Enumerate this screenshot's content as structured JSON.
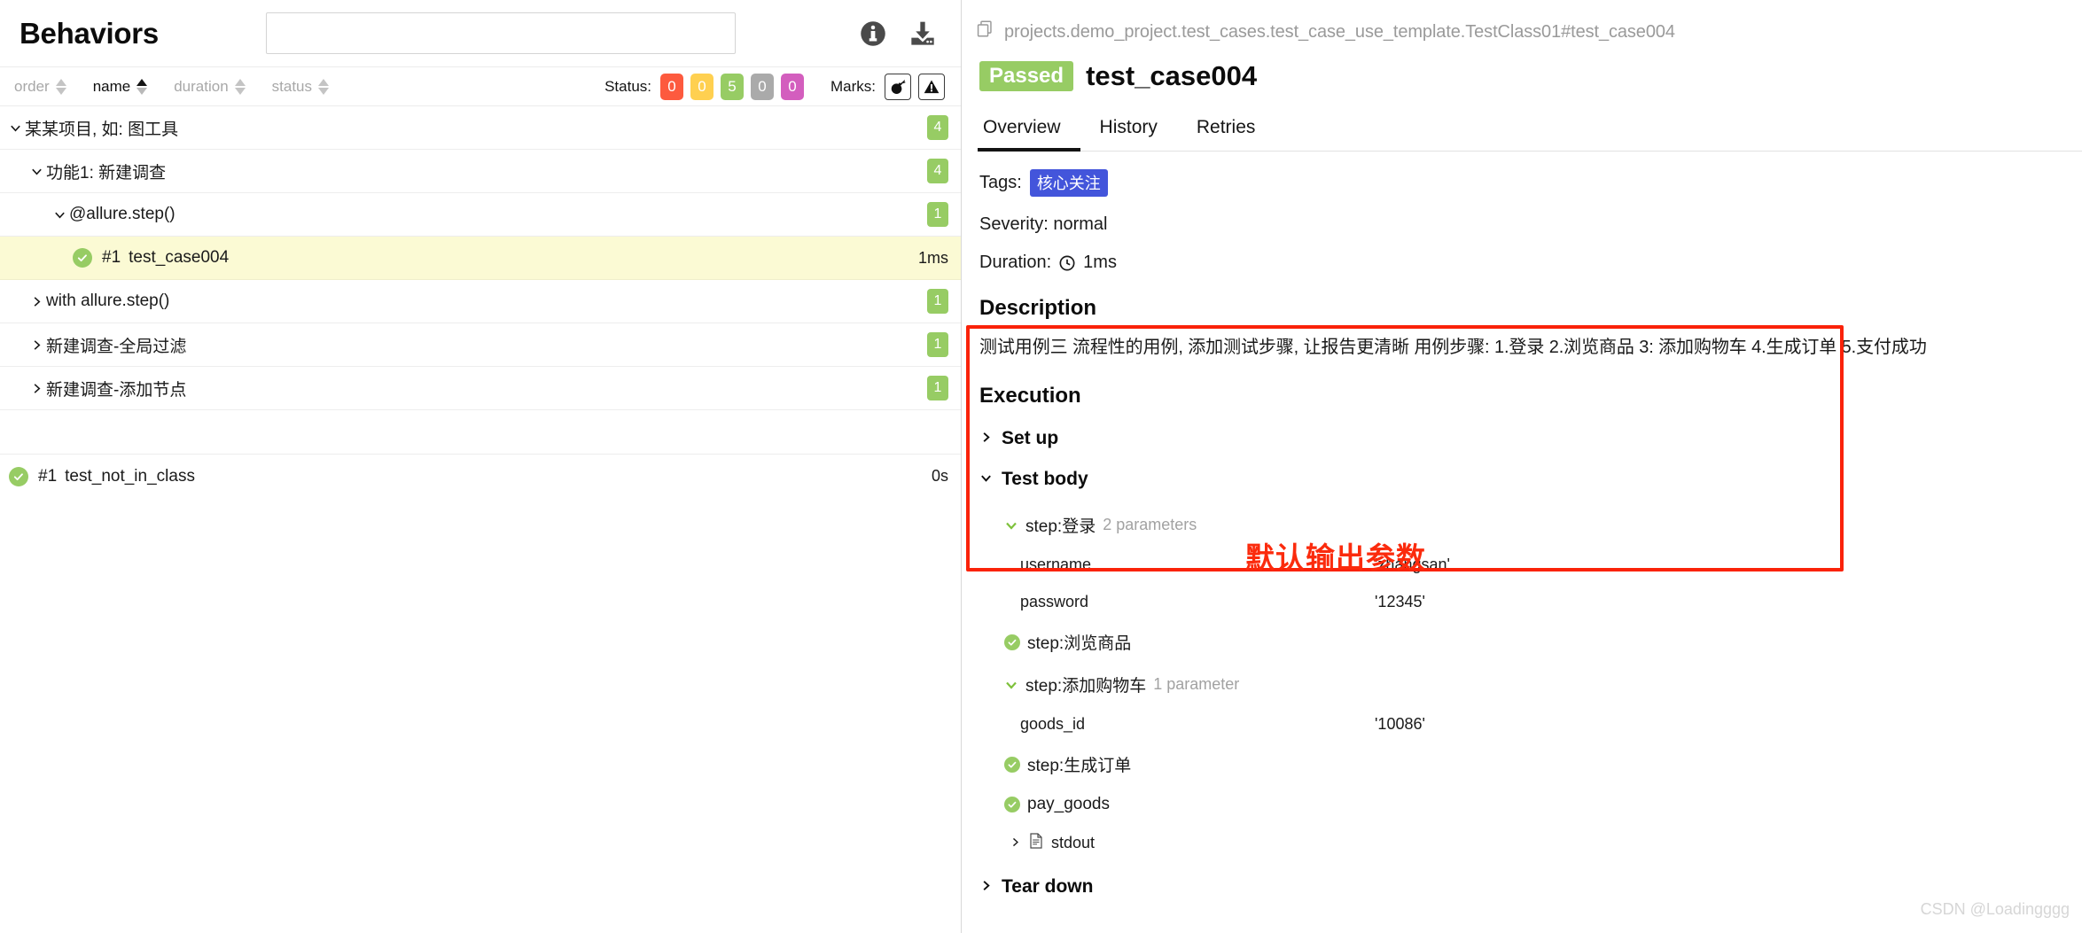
{
  "left_panel": {
    "title": "Behaviors",
    "search": {
      "value": "",
      "placeholder": ""
    },
    "icons": {
      "info": "info-icon",
      "download": "download-icon"
    },
    "sort_fields": [
      {
        "label": "order",
        "active": false
      },
      {
        "label": "name",
        "active": true
      },
      {
        "label": "duration",
        "active": false
      },
      {
        "label": "status",
        "active": false
      }
    ],
    "status_filter": {
      "caption": "Status:",
      "badges": [
        {
          "value": "0",
          "color": "#fd5a3e",
          "name": "failed"
        },
        {
          "value": "0",
          "color": "#ffd050",
          "name": "broken"
        },
        {
          "value": "5",
          "color": "#97cc64",
          "name": "passed"
        },
        {
          "value": "0",
          "color": "#aaaaaa",
          "name": "skipped"
        },
        {
          "value": "0",
          "color": "#d35ebe",
          "name": "unknown"
        }
      ]
    },
    "marks_filter": {
      "caption": "Marks:",
      "items": [
        "bomb-icon",
        "warning-triangle-icon"
      ]
    },
    "tree": [
      {
        "level": 0,
        "chevron": "down",
        "label": "某某项目, 如: 图工具",
        "badge": "4",
        "selected": false,
        "type": "node"
      },
      {
        "level": 1,
        "chevron": "down",
        "label": "功能1: 新建调查",
        "badge": "4",
        "selected": false,
        "type": "node"
      },
      {
        "level": 2,
        "chevron": "down",
        "label": "@allure.step()",
        "badge": "1",
        "selected": false,
        "type": "node"
      },
      {
        "level": 3,
        "chevron": "none",
        "label": "test_case004",
        "number": "#1",
        "duration": "1ms",
        "selected": true,
        "type": "leaf"
      },
      {
        "level": 1,
        "chevron": "right",
        "label": "with allure.step()",
        "badge": "1",
        "selected": false,
        "type": "node"
      },
      {
        "level": 1,
        "chevron": "right",
        "label": "新建调查-全局过滤",
        "badge": "1",
        "selected": false,
        "type": "node"
      },
      {
        "level": 1,
        "chevron": "right",
        "label": "新建调查-添加节点",
        "badge": "1",
        "selected": false,
        "type": "node"
      }
    ],
    "orphan_test": {
      "number": "#1",
      "label": "test_not_in_class",
      "duration": "0s"
    }
  },
  "right_panel": {
    "breadcrumb": "projects.demo_project.test_cases.test_case_use_template.TestClass01#test_case004",
    "breadcrumb_icon": "copy-pages-icon",
    "status_badge": "Passed",
    "status_color": "#97cc64",
    "title": "test_case004",
    "tabs": [
      {
        "label": "Overview",
        "active": true
      },
      {
        "label": "History",
        "active": false
      },
      {
        "label": "Retries",
        "active": false
      }
    ],
    "meta": {
      "tags_label": "Tags:",
      "tags": [
        "核心关注"
      ],
      "tag_color": "#4355db",
      "severity": "Severity: normal",
      "duration_label": "Duration:",
      "duration_value": "1ms"
    },
    "description_heading": "Description",
    "description_text": "测试用例三 流程性的用例, 添加测试步骤, 让报告更清晰 用例步骤: 1.登录 2.浏览商品 3: 添加购物车 4.生成订单 5.支付成功",
    "execution_heading": "Execution",
    "setup": {
      "label": "Set up",
      "chevron": "right"
    },
    "test_body": {
      "label": "Test body",
      "chevron": "down"
    },
    "steps": [
      {
        "kind": "step",
        "chevron": "down",
        "icon": "chevron-down-green",
        "name": "step:登录",
        "params_count": "2 parameters"
      },
      {
        "kind": "param",
        "name": "username",
        "value": "'zhangsan'"
      },
      {
        "kind": "param",
        "name": "password",
        "value": "'12345'"
      },
      {
        "kind": "step",
        "chevron": "none",
        "icon": "check-circle",
        "name": "step:浏览商品",
        "params_count": ""
      },
      {
        "kind": "step",
        "chevron": "down",
        "icon": "chevron-down-green",
        "name": "step:添加购物车",
        "params_count": "1 parameter"
      },
      {
        "kind": "param",
        "name": "goods_id",
        "value": "'10086'"
      },
      {
        "kind": "step",
        "chevron": "none",
        "icon": "check-circle",
        "name": "step:生成订单",
        "params_count": ""
      },
      {
        "kind": "step",
        "chevron": "none",
        "icon": "check-circle",
        "name": "pay_goods",
        "params_count": ""
      },
      {
        "kind": "attachment",
        "chevron": "right",
        "icon": "file-icon",
        "name": "stdout"
      }
    ],
    "annotation": {
      "text": "默认输出参数",
      "color": "#fb2b0d"
    },
    "teardown": {
      "label": "Tear down",
      "chevron": "right"
    },
    "watermark": "CSDN @Loadingggg"
  }
}
